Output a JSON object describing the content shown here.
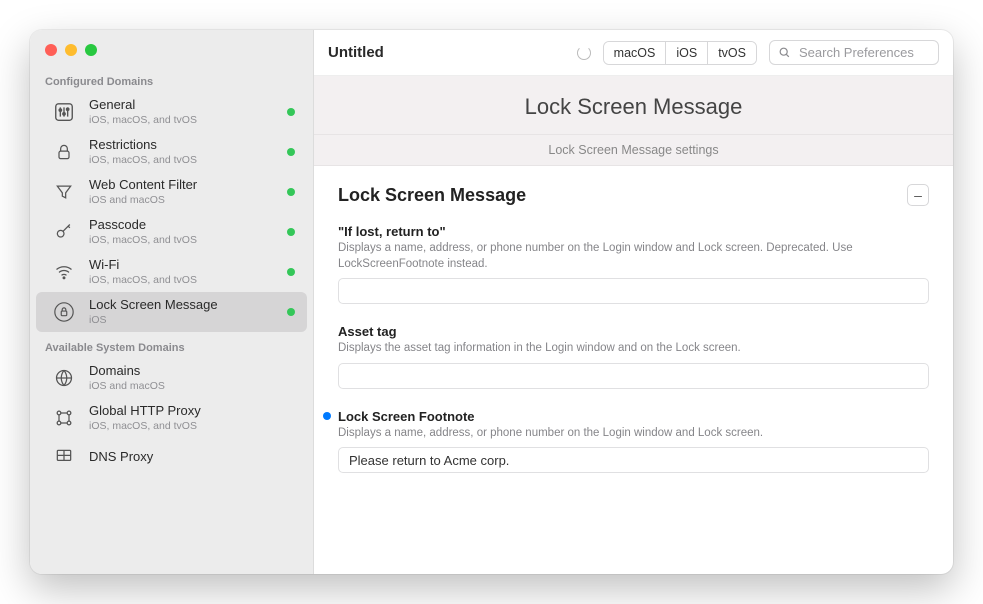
{
  "window": {
    "title": "Untitled"
  },
  "platforms": {
    "macos": "macOS",
    "ios": "iOS",
    "tvos": "tvOS"
  },
  "search": {
    "placeholder": "Search Preferences"
  },
  "sidebar": {
    "configured_title": "Configured Domains",
    "available_title": "Available System Domains",
    "configured": [
      {
        "label": "General",
        "sub": "iOS, macOS, and tvOS",
        "icon": "sliders"
      },
      {
        "label": "Restrictions",
        "sub": "iOS, macOS, and tvOS",
        "icon": "lock"
      },
      {
        "label": "Web Content Filter",
        "sub": "iOS and macOS",
        "icon": "funnel"
      },
      {
        "label": "Passcode",
        "sub": "iOS, macOS, and tvOS",
        "icon": "key"
      },
      {
        "label": "Wi-Fi",
        "sub": "iOS, macOS, and tvOS",
        "icon": "wifi"
      },
      {
        "label": "Lock Screen Message",
        "sub": "iOS",
        "icon": "lockcircle"
      }
    ],
    "available": [
      {
        "label": "Domains",
        "sub": "iOS and macOS",
        "icon": "globe"
      },
      {
        "label": "Global HTTP Proxy",
        "sub": "iOS, macOS, and tvOS",
        "icon": "network"
      },
      {
        "label": "DNS Proxy",
        "sub": "",
        "icon": "grid"
      }
    ]
  },
  "header": {
    "title": "Lock Screen Message",
    "subtitle": "Lock Screen Message settings"
  },
  "panel": {
    "title": "Lock Screen Message",
    "collapse_glyph": "–",
    "fields": [
      {
        "label": "\"If lost, return to\"",
        "desc": "Displays a name, address, or phone number on the Login window and Lock screen. Deprecated. Use LockScreenFootnote instead.",
        "value": "",
        "modified": false
      },
      {
        "label": "Asset tag",
        "desc": "Displays the asset tag information in the Login window and on the Lock screen.",
        "value": "",
        "modified": false
      },
      {
        "label": "Lock Screen Footnote",
        "desc": "Displays a name, address, or phone number on the Login window and Lock screen.",
        "value": "Please return to Acme corp.",
        "modified": true
      }
    ]
  }
}
